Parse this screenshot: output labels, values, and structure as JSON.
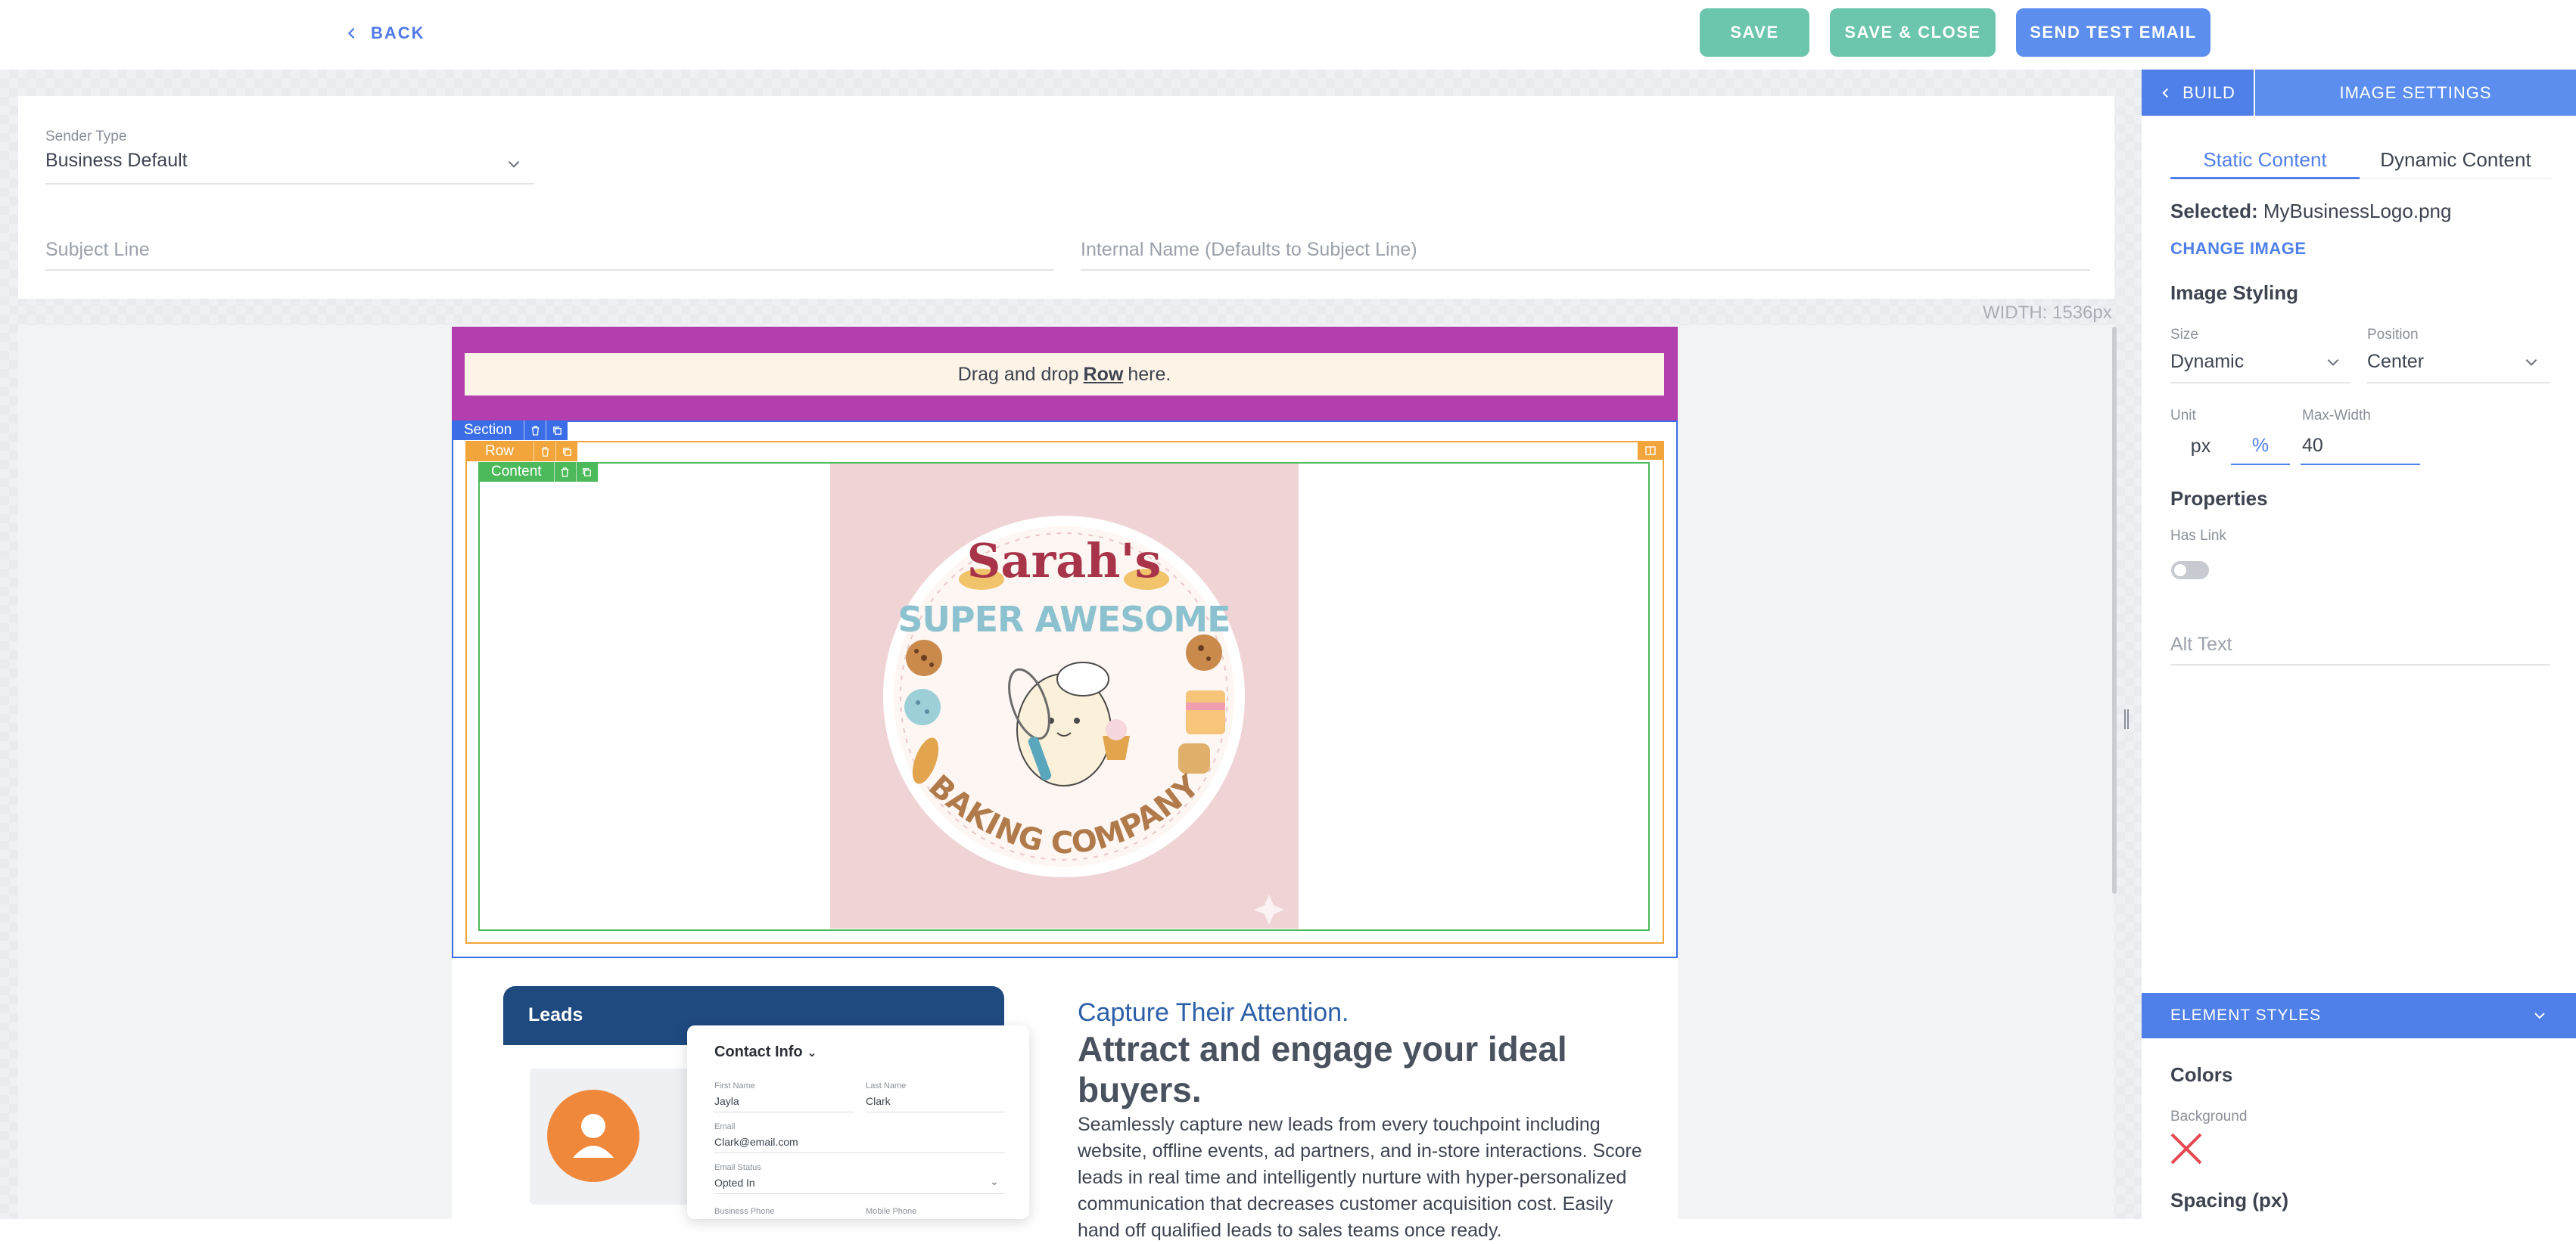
{
  "topbar": {
    "back_label": "BACK",
    "save_label": "SAVE",
    "save_close_label": "SAVE & CLOSE",
    "send_test_label": "SEND TEST EMAIL"
  },
  "form": {
    "sender_type_label": "Sender Type",
    "sender_type_value": "Business Default",
    "subject_placeholder": "Subject Line",
    "internal_name_placeholder": "Internal Name (Defaults to Subject Line)"
  },
  "canvas": {
    "width_label": "WIDTH: 1536px",
    "drop_prefix": "Drag and drop",
    "drop_bold": "Row",
    "drop_suffix": "here.",
    "tag_section": "Section",
    "tag_row": "Row",
    "tag_content": "Content"
  },
  "logo": {
    "line1": "Sarah's",
    "line2": "SUPER AWESOME",
    "line3": "BAKING COMPANY"
  },
  "leads": {
    "title": "Leads",
    "contact_info": "Contact Info",
    "first_name_label": "First Name",
    "first_name_value": "Jayla",
    "last_name_label": "Last Name",
    "last_name_value": "Clark",
    "email_label": "Email",
    "email_value": "Clark@email.com",
    "email_status_label": "Email Status",
    "email_status_value": "Opted In",
    "business_phone_label": "Business Phone",
    "mobile_phone_label": "Mobile Phone"
  },
  "marketing": {
    "capture": "Capture Their Attention.",
    "headline": "Attract and engage your ideal buyers.",
    "paragraph": "Seamlessly capture new leads from every touchpoint including website, offline events, ad partners, and in-store interactions. Score leads in real time and intelligently nurture with hyper-personalized communication that decreases customer acquisition cost. Easily hand off qualified leads to sales teams once ready."
  },
  "panel": {
    "build_label": "BUILD",
    "image_settings_label": "IMAGE SETTINGS",
    "tab_static": "Static Content",
    "tab_dynamic": "Dynamic Content",
    "selected_label": "Selected:",
    "selected_file": "MyBusinessLogo.png",
    "change_image": "CHANGE IMAGE",
    "image_styling": "Image Styling",
    "size_label": "Size",
    "size_value": "Dynamic",
    "position_label": "Position",
    "position_value": "Center",
    "unit_label": "Unit",
    "unit_px": "px",
    "unit_pct": "%",
    "max_width_label": "Max-Width",
    "max_width_value": "40",
    "properties": "Properties",
    "has_link_label": "Has Link",
    "alt_text_placeholder": "Alt Text",
    "element_styles": "ELEMENT STYLES",
    "colors": "Colors",
    "background_label": "Background",
    "spacing": "Spacing (px)"
  },
  "colors": {
    "accent": "#4f7fe8",
    "save_green": "#6cc5ad",
    "section_blue": "#3b6ee6",
    "row_orange": "#f2a53a",
    "content_green": "#4cba5a",
    "purple": "#b23fad",
    "no_color_red": "#e5484d"
  }
}
